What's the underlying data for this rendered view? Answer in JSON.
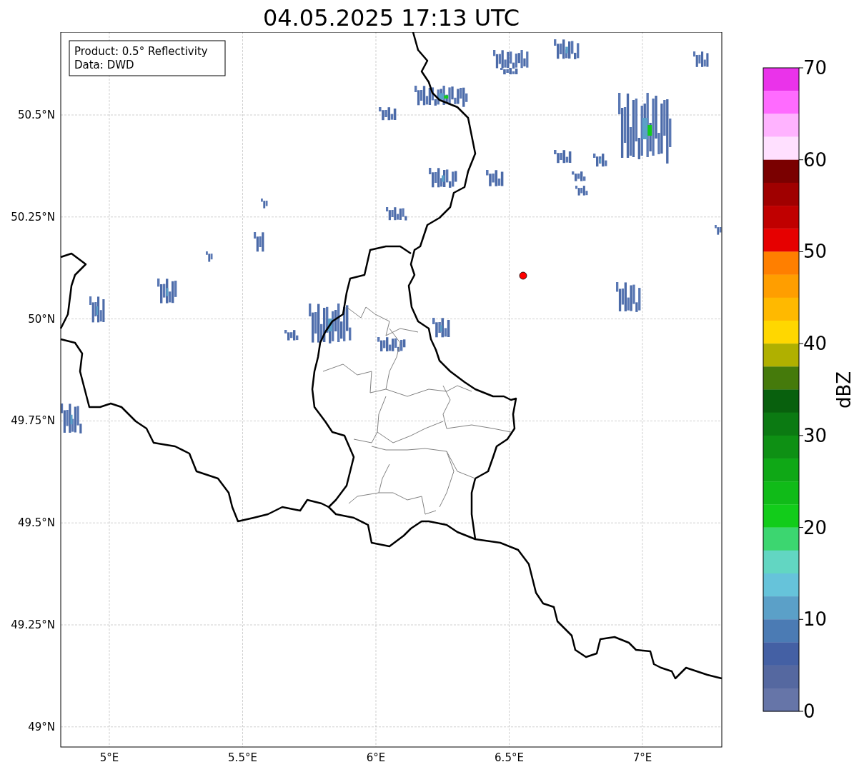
{
  "title": "04.05.2025 17:13 UTC",
  "legend": [
    "Product: 0.5° Reflectivity",
    "Data: DWD"
  ],
  "x_ticks": [
    "5°E",
    "5.5°E",
    "6°E",
    "6.5°E",
    "7°E"
  ],
  "y_ticks": [
    "50.5°N",
    "50.25°N",
    "50°N",
    "49.75°N",
    "49.5°N",
    "49.25°N",
    "49°N"
  ],
  "colorbar": {
    "label": "dBZ",
    "ticks": [
      "70",
      "60",
      "50",
      "40",
      "30",
      "20",
      "10",
      "0"
    ],
    "bands": [
      {
        "color": "#ea33ea"
      },
      {
        "color": "#ff6bff"
      },
      {
        "color": "#ffb3ff"
      },
      {
        "color": "#ffe0ff"
      },
      {
        "color": "#7a0000"
      },
      {
        "color": "#a00000"
      },
      {
        "color": "#c00000"
      },
      {
        "color": "#e60000"
      },
      {
        "color": "#ff7f00"
      },
      {
        "color": "#ff9e00"
      },
      {
        "color": "#ffb900"
      },
      {
        "color": "#ffd700"
      },
      {
        "color": "#b0b000"
      },
      {
        "color": "#457a0b"
      },
      {
        "color": "#08600d"
      },
      {
        "color": "#0b7a12"
      },
      {
        "color": "#0e9014"
      },
      {
        "color": "#0fa816"
      },
      {
        "color": "#10bb18"
      },
      {
        "color": "#12cc1a"
      },
      {
        "color": "#3cd670"
      },
      {
        "color": "#62d6c2"
      },
      {
        "color": "#66c3da"
      },
      {
        "color": "#5ba0c8"
      },
      {
        "color": "#4b7bb4"
      },
      {
        "color": "#4460a4"
      },
      {
        "color": "#5568a0"
      },
      {
        "color": "#6675a8"
      }
    ]
  }
}
